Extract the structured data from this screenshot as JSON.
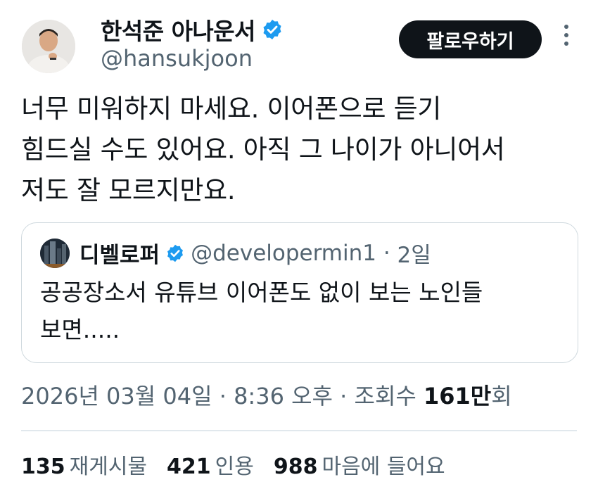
{
  "author": {
    "name": "한석준 아나운서",
    "handle": "@hansukjoon",
    "verified": true
  },
  "follow_button_label": "팔로우하기",
  "tweet_lines": [
    "너무 미워하지 마세요. 이어폰으로 듣기",
    "힘드실 수도 있어요. 아직 그 나이가 아니어서",
    "저도 잘 모르지만요."
  ],
  "quoted": {
    "name": "디벨로퍼",
    "handle": "@developermin1",
    "separator": " · ",
    "time": "2일",
    "lines": [
      "공공장소서 유튜브 이어폰도 없이 보는 노인들",
      "보면....."
    ]
  },
  "meta": {
    "date": "2026년 03월 04일",
    "sep1": " · ",
    "time": "8:36 오후",
    "sep2": " · ",
    "views_label": "조회수 ",
    "views_number": "161",
    "views_unit": "만",
    "views_suffix": "회"
  },
  "stats": [
    {
      "count": "135",
      "label": "재게시물"
    },
    {
      "count": "421",
      "label": "인용"
    },
    {
      "count": "988",
      "label": "마음에 들어요"
    }
  ],
  "colors": {
    "verified_blue": "#1d9bf0",
    "text_primary": "#0f1419",
    "text_secondary": "#536471",
    "follow_bg": "#0f1419"
  },
  "icons": {
    "verified": "verified-badge-icon",
    "more": "more-vertical-icon"
  }
}
